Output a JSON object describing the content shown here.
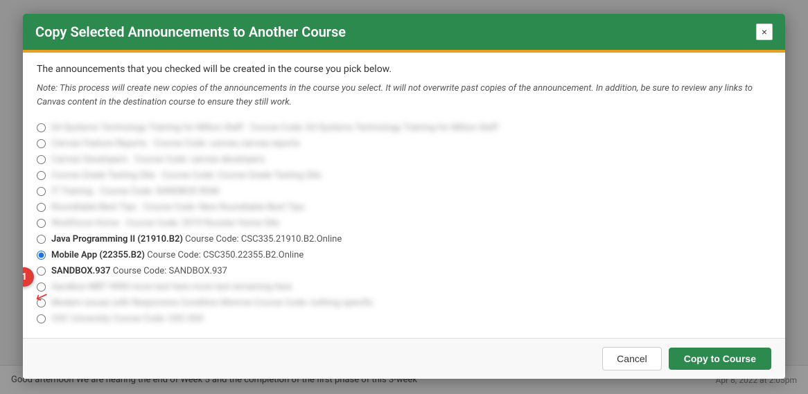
{
  "modal": {
    "title": "Copy Selected Announcements to Another Course",
    "close_label": "×",
    "intro": "The announcements that you checked will be created in the course you pick below.",
    "note": "Note: This process will create new copies of the announcements in the course you select. It will not overwrite past copies of the announcement. In addition, be sure to review any links to Canvas content in the destination course to ensure they still work.",
    "courses": [
      {
        "id": "c1",
        "blurred": true,
        "name": "Ed Systems Technology Training for Milton Staff",
        "code": "Course Code: Ed Systems Technology Training for Milton Staff"
      },
      {
        "id": "c2",
        "blurred": true,
        "name": "Canvas Feature Reports",
        "code": "Course Code: canvas.canvas.reports"
      },
      {
        "id": "c3",
        "blurred": true,
        "name": "Canvas Developers",
        "code": "Course Code: canvas.developers"
      },
      {
        "id": "c4",
        "blurred": true,
        "name": "Course Grade Testing Site",
        "code": "Course Code: Course Grade Testing Site"
      },
      {
        "id": "c5",
        "blurred": true,
        "name": "IT Training",
        "code": "Course Code: SANDBOX.9044"
      },
      {
        "id": "c6",
        "blurred": true,
        "name": "Roundtable Best Tips",
        "code": "Course Code: New Roundtable Best Tips"
      },
      {
        "id": "c7",
        "blurred": true,
        "name": "Workforce Home",
        "code": "Course Code: 2019 Rooster Home Site"
      },
      {
        "id": "c8",
        "blurred": false,
        "name": "Java Programming II (21910.B2)",
        "code": "Course Code: CSC335.21910.B2.Online",
        "selected": false
      },
      {
        "id": "c9",
        "blurred": false,
        "name": "Mobile App (22355.B2)",
        "code": "Course Code: CSC350.22355.B2.Online",
        "selected": true
      },
      {
        "id": "c10",
        "blurred": false,
        "name": "SANDBOX.937",
        "code": "Course Code: SANDBOX.937",
        "selected": false
      },
      {
        "id": "c11",
        "blurred": true,
        "name": "Sandbox MBT 9900 more text here",
        "code": "more text remaining here"
      },
      {
        "id": "c12",
        "blurred": true,
        "name": "Modern Issues with Responsive Condition Monroe",
        "code": "Course Code: nothing specific"
      },
      {
        "id": "c13",
        "blurred": true,
        "name": "OSC University",
        "code": "Course Code: OSC.004"
      }
    ],
    "footer": {
      "cancel_label": "Cancel",
      "copy_label": "Copy to Course"
    }
  },
  "bottom_bar": {
    "text": "Good afternoon We are nearing the end of Week 5 and the completion of the first phase of this 3-week",
    "date": "Apr 8, 2022 at 2:05pm"
  },
  "annotation": {
    "badge": "1"
  }
}
